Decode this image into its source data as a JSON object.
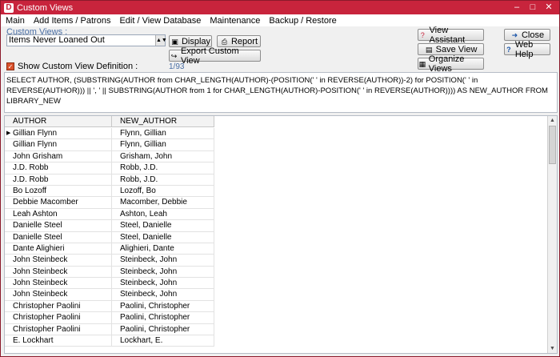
{
  "window": {
    "title": "Custom Views",
    "app_icon": "D"
  },
  "menu": [
    "Main",
    "Add Items / Patrons",
    "Edit / View Database",
    "Maintenance",
    "Backup / Restore"
  ],
  "custom_views": {
    "label": "Custom Views :",
    "selected": "Items Never Loaned Out",
    "show_definition_label": "Show Custom View Definition :",
    "show_definition_checked": true,
    "counter": "1/93"
  },
  "buttons": {
    "display": "Display",
    "report": "Report",
    "export": "Export Custom View",
    "view_assistant": "View Assistant",
    "save_view": "Save View",
    "organize_views": "Organize Views",
    "close": "Close",
    "web_help": "Web Help"
  },
  "sql": "SELECT AUTHOR, (SUBSTRING(AUTHOR from CHAR_LENGTH(AUTHOR)-(POSITION(' ' in REVERSE(AUTHOR))-2) for POSITION(' ' in REVERSE(AUTHOR))) || ', ' || SUBSTRING(AUTHOR from 1 for CHAR_LENGTH(AUTHOR)-POSITION(' ' in REVERSE(AUTHOR)))) AS NEW_AUTHOR FROM LIBRARY_NEW",
  "grid": {
    "columns": [
      "AUTHOR",
      "NEW_AUTHOR"
    ],
    "rows": [
      [
        "Gillian Flynn",
        "Flynn, Gillian"
      ],
      [
        "Gillian Flynn",
        "Flynn, Gillian"
      ],
      [
        "John Grisham",
        "Grisham, John"
      ],
      [
        "J.D. Robb",
        "Robb, J.D."
      ],
      [
        "J.D. Robb",
        "Robb, J.D."
      ],
      [
        "Bo Lozoff",
        "Lozoff, Bo"
      ],
      [
        "Debbie Macomber",
        "Macomber, Debbie"
      ],
      [
        "Leah Ashton",
        "Ashton, Leah"
      ],
      [
        "Danielle Steel",
        "Steel, Danielle"
      ],
      [
        "Danielle Steel",
        "Steel, Danielle"
      ],
      [
        "Dante Alighieri",
        "Alighieri, Dante"
      ],
      [
        "John Steinbeck",
        "Steinbeck, John"
      ],
      [
        "John Steinbeck",
        "Steinbeck, John"
      ],
      [
        "John Steinbeck",
        "Steinbeck, John"
      ],
      [
        "John Steinbeck",
        "Steinbeck, John"
      ],
      [
        "Christopher Paolini",
        "Paolini, Christopher"
      ],
      [
        "Christopher Paolini",
        "Paolini, Christopher"
      ],
      [
        "Christopher Paolini",
        "Paolini, Christopher"
      ],
      [
        "E. Lockhart",
        "Lockhart, E."
      ]
    ]
  },
  "colors": {
    "title_bar": "#c8243c",
    "selection": "#ec6b31",
    "label_blue": "#4a6fa5"
  }
}
